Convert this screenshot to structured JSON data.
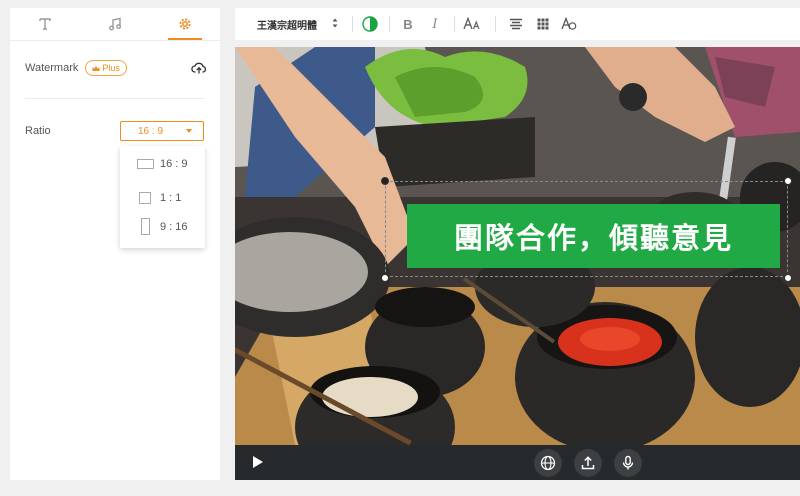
{
  "sidebar": {
    "tabs": [
      {
        "name": "text-icon",
        "active": false
      },
      {
        "name": "music-icon",
        "active": false
      },
      {
        "name": "gear-icon",
        "active": true
      }
    ],
    "watermark_label": "Watermark",
    "plus_badge": "Plus",
    "ratio_label": "Ratio",
    "ratio_selected": "16 : 9",
    "ratio_options": [
      "16 : 9",
      "1 : 1",
      "9 : 16"
    ]
  },
  "toolbar": {
    "font_name": "王漢宗超明體",
    "icons": [
      "color-circle-icon",
      "bold-icon",
      "italic-icon",
      "font-size-icon",
      "align-center-icon",
      "grid-icon",
      "text-effect-icon"
    ]
  },
  "canvas": {
    "caption_text": "團隊合作，傾聽意見"
  },
  "colors": {
    "accent": "#f08c24",
    "caption_bg": "#21a946",
    "bottom_bar": "#262a2c"
  }
}
